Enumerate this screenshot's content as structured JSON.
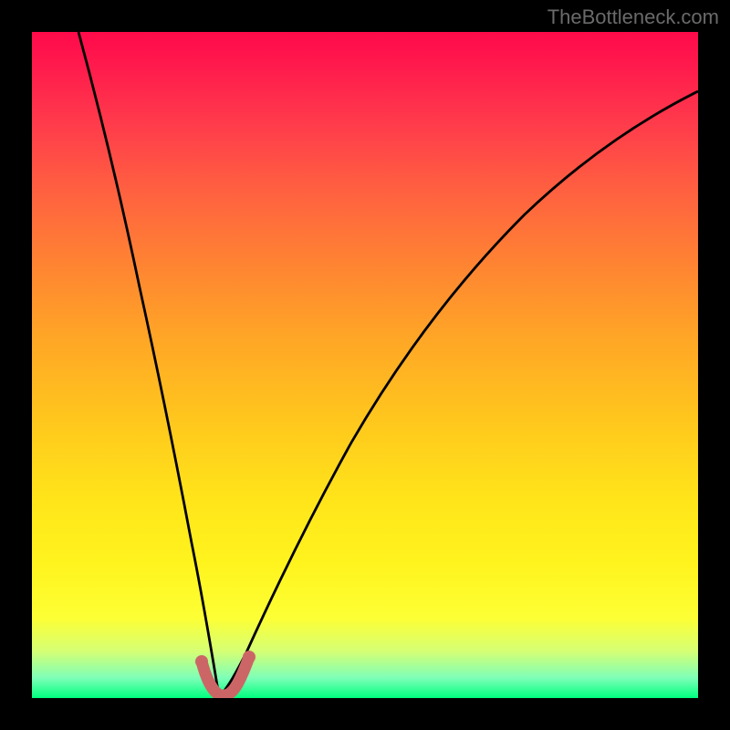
{
  "watermark": "TheBottleneck.com",
  "chart_data": {
    "type": "line",
    "title": "",
    "xlabel": "",
    "ylabel": "",
    "xlim": [
      0,
      100
    ],
    "ylim": [
      0,
      100
    ],
    "series": [
      {
        "name": "curve-left",
        "x": [
          7,
          9,
          11,
          13,
          15,
          17,
          19,
          21,
          23,
          25,
          26,
          27,
          28
        ],
        "values": [
          100,
          90,
          80,
          70,
          60,
          49,
          38,
          27,
          15,
          5,
          2,
          0.5,
          0
        ]
      },
      {
        "name": "curve-right",
        "x": [
          28,
          30,
          33,
          37,
          42,
          48,
          55,
          63,
          72,
          82,
          93,
          100
        ],
        "values": [
          0,
          1,
          5,
          12,
          22,
          34,
          46,
          57,
          67,
          76,
          84,
          88
        ]
      }
    ],
    "marker": {
      "name": "bottleneck-minimum",
      "x": 27,
      "y": 0.5,
      "color": "#cc6666"
    },
    "background_gradient": {
      "stops": [
        {
          "pos": 0.0,
          "color": "#ff0a4a"
        },
        {
          "pos": 0.35,
          "color": "#ff8432"
        },
        {
          "pos": 0.7,
          "color": "#ffe41a"
        },
        {
          "pos": 1.0,
          "color": "#00ff7e"
        }
      ]
    }
  }
}
